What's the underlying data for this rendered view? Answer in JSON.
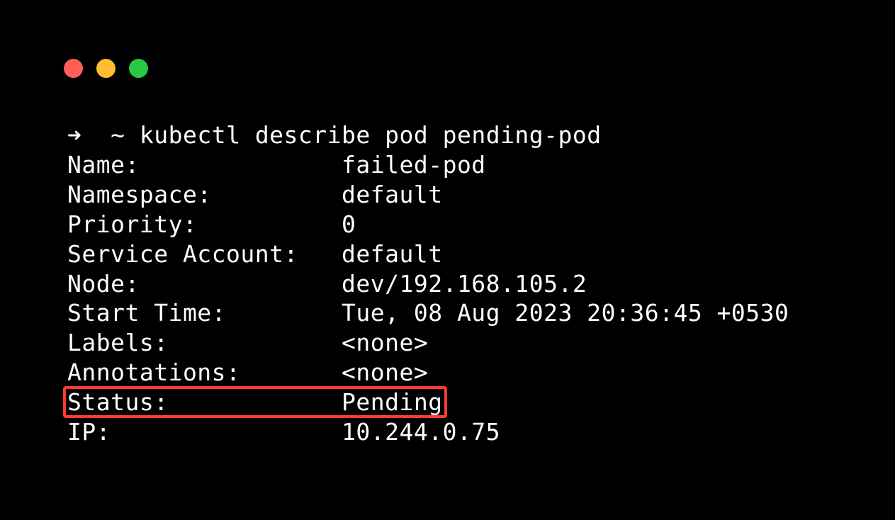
{
  "window": {
    "traffic_lights": [
      "close",
      "minimize",
      "zoom"
    ]
  },
  "prompt": {
    "arrow": "➜",
    "tilde": "~",
    "command": "kubectl describe pod pending-pod"
  },
  "fields": [
    {
      "label": "Name:",
      "value": "failed-pod"
    },
    {
      "label": "Namespace:",
      "value": "default"
    },
    {
      "label": "Priority:",
      "value": "0"
    },
    {
      "label": "Service Account:",
      "value": "default"
    },
    {
      "label": "Node:",
      "value": "dev/192.168.105.2"
    },
    {
      "label": "Start Time:",
      "value": "Tue, 08 Aug 2023 20:36:45 +0530"
    },
    {
      "label": "Labels:",
      "value": "<none>"
    },
    {
      "label": "Annotations:",
      "value": "<none>"
    },
    {
      "label": "Status:",
      "value": "Pending"
    },
    {
      "label": "IP:",
      "value": "10.244.0.75"
    }
  ],
  "highlight": {
    "field_label": "Status:",
    "field_value": "Pending"
  }
}
